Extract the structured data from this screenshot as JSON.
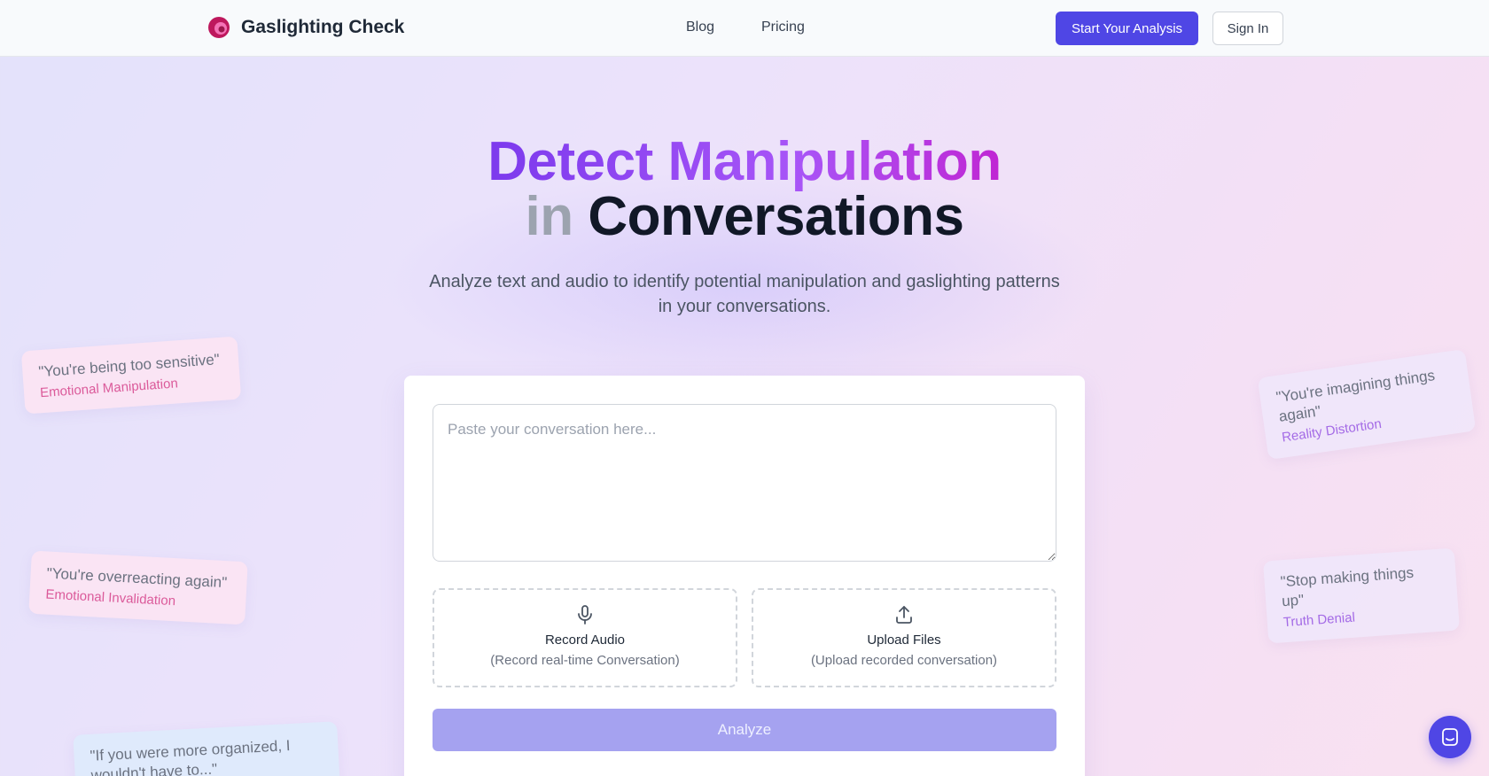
{
  "header": {
    "brand_name": "Gaslighting Check",
    "nav": [
      "Blog",
      "Pricing"
    ],
    "cta_label": "Start Your Analysis",
    "signin_label": "Sign In"
  },
  "hero": {
    "title_line1": "Detect Manipulation",
    "title_in": "in",
    "title_line2": "Conversations",
    "subtitle_line1": "Analyze text and audio to identify potential manipulation and gaslighting patterns",
    "subtitle_line2": "in your conversations."
  },
  "form": {
    "placeholder": "Paste your conversation here...",
    "record_title": "Record Audio",
    "record_sub": "(Record real-time Conversation)",
    "upload_title": "Upload Files",
    "upload_sub": "(Upload recorded conversation)",
    "analyze_label": "Analyze"
  },
  "quotes": [
    {
      "text": "\"You're being too sensitive\"",
      "tag": "Emotional Manipulation"
    },
    {
      "text": "\"You're overreacting again\"",
      "tag": "Emotional Invalidation"
    },
    {
      "text": "\"If you were more organized, I wouldn't have to...\"",
      "tag": ""
    },
    {
      "text": "\"You're imagining things again\"",
      "tag": "Reality Distortion"
    },
    {
      "text": "\"Stop making things up\"",
      "tag": "Truth Denial"
    }
  ],
  "colors": {
    "accent": "#4f46e5",
    "analyze_disabled": "#a5a2f0",
    "gradient_start": "#7c3aed",
    "gradient_end": "#c026d3"
  },
  "icons": {
    "brand": "brand-logo-icon",
    "record": "microphone-icon",
    "upload": "upload-icon",
    "chat": "chat-icon"
  }
}
